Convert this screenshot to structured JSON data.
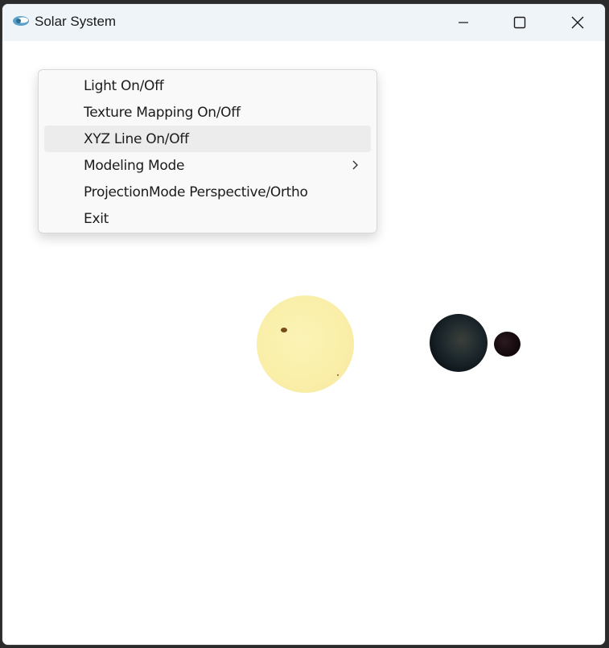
{
  "window": {
    "title": "Solar System"
  },
  "titlebar": {
    "minimize_icon": "minimize-icon",
    "maximize_icon": "maximize-icon",
    "close_icon": "close-icon"
  },
  "context_menu": {
    "items": [
      {
        "label": "Light On/Off"
      },
      {
        "label": "Texture Mapping On/Off"
      },
      {
        "label": "XYZ Line On/Off",
        "highlighted": true
      },
      {
        "label": "Modeling Mode",
        "has_submenu": true
      },
      {
        "label": "ProjectionMode Perspective/Ortho"
      },
      {
        "label": "Exit"
      }
    ]
  },
  "scene": {
    "bodies": [
      "sun",
      "earth",
      "moon"
    ],
    "colors": {
      "sun": "#faefa9",
      "earth": "#1f2a2e",
      "moon": "#14090d",
      "background": "#ffffff"
    }
  }
}
